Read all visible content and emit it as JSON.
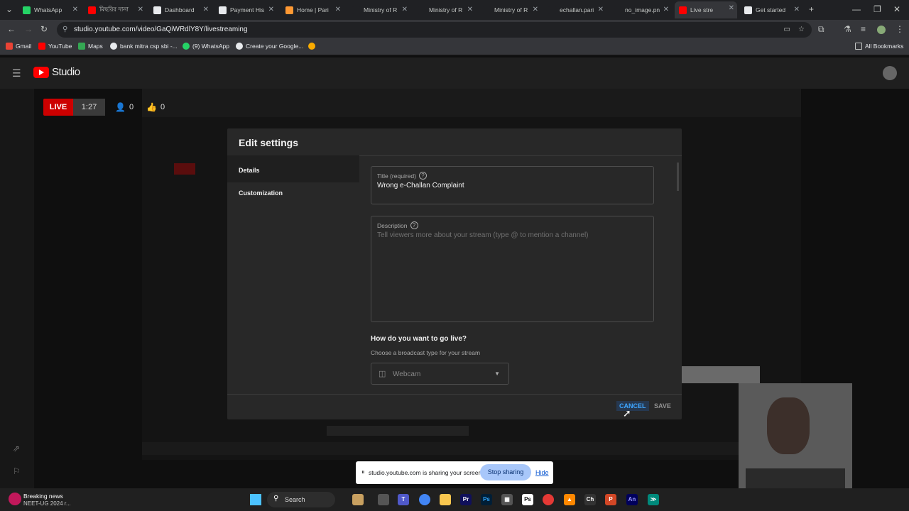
{
  "tabs": [
    {
      "title": "WhatsApp",
      "fav": "#25d366"
    },
    {
      "title": "মিছরির দানা",
      "fav": "#ff0000"
    },
    {
      "title": "Dashboard",
      "fav": "#e8eaed"
    },
    {
      "title": "Payment His",
      "fav": "#e8eaed"
    },
    {
      "title": "Home | Pari",
      "fav": "#ff9933"
    },
    {
      "title": "Ministry of R",
      "fav": "#202124"
    },
    {
      "title": "Ministry of R",
      "fav": "#202124"
    },
    {
      "title": "Ministry of R",
      "fav": "#202124"
    },
    {
      "title": "echallan.pari",
      "fav": "#202124"
    },
    {
      "title": "no_image.pn",
      "fav": "#202124"
    },
    {
      "title": "Live stre",
      "fav": "#ff0000"
    },
    {
      "title": "Get started",
      "fav": "#e8eaed"
    }
  ],
  "address": {
    "url": "studio.youtube.com/video/GaQiWRdlY8Y/livestreaming"
  },
  "bookmarks": [
    "Gmail",
    "YouTube",
    "Maps",
    "bank mitra csp sbi -...",
    "(9) WhatsApp",
    "Create your Google..."
  ],
  "bookmarks_right": "All Bookmarks",
  "studio": {
    "brand": "Studio"
  },
  "live": {
    "badge": "LIVE",
    "time": "1:27",
    "viewers": "0",
    "likes": "0"
  },
  "dialog": {
    "title": "Edit settings",
    "tabs": [
      "Details",
      "Customization"
    ],
    "title_field": {
      "label": "Title (required)",
      "value": "Wrong  e-Challan Complaint"
    },
    "description_field": {
      "label": "Description",
      "placeholder": "Tell viewers more about your stream (type @ to mention a channel)"
    },
    "golive": {
      "heading": "How do you want to go live?",
      "sub": "Choose a broadcast type for your stream",
      "select": "Webcam"
    },
    "cancel": "CANCEL",
    "save": "SAVE"
  },
  "sharebar": {
    "message": "studio.youtube.com is sharing your screen.",
    "stop": "Stop sharing",
    "hide": "Hide"
  },
  "taskbar": {
    "news_title": "Breaking news",
    "news_sub": "NEET-UG 2024 r...",
    "search": "Search"
  }
}
